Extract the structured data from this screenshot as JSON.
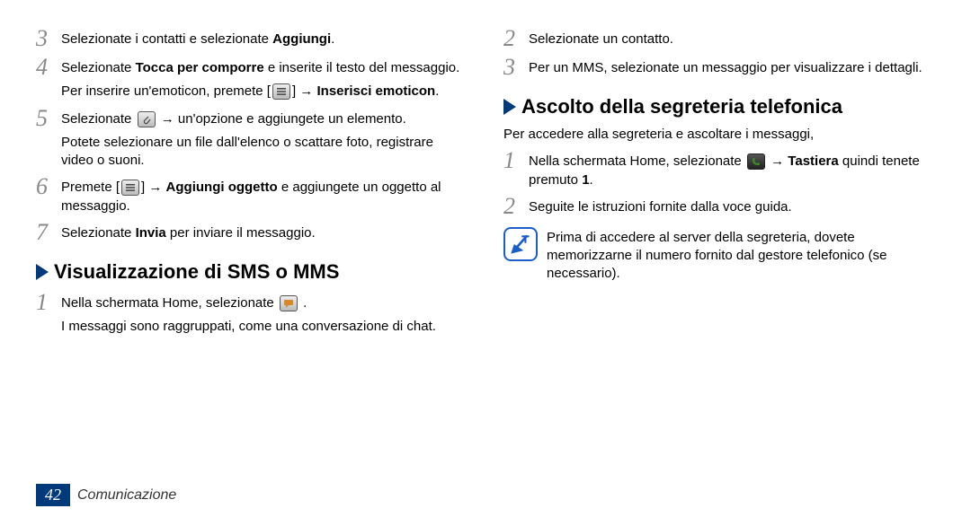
{
  "left": {
    "steps": [
      {
        "num": "3",
        "parts": [
          {
            "t": "Selezionate i contatti e selezionate "
          },
          {
            "t": "Aggiungi",
            "b": true
          },
          {
            "t": "."
          }
        ]
      },
      {
        "num": "4",
        "parts": [
          {
            "t": "Selezionate "
          },
          {
            "t": "Tocca per comporre",
            "b": true
          },
          {
            "t": " e inserite il testo del messaggio."
          }
        ],
        "sub": [
          {
            "t": "Per inserire un'emoticon, premete ["
          },
          {
            "icon": "menu"
          },
          {
            "t": "] → "
          },
          {
            "t": "Inserisci emoticon",
            "b": true
          },
          {
            "t": "."
          }
        ]
      },
      {
        "num": "5",
        "parts": [
          {
            "t": "Selezionate "
          },
          {
            "icon": "attach"
          },
          {
            "t": " → un'opzione e aggiungete un elemento."
          }
        ],
        "sub": [
          {
            "t": "Potete selezionare un file dall'elenco o scattare foto, registrare video o suoni."
          }
        ]
      },
      {
        "num": "6",
        "parts": [
          {
            "t": "Premete ["
          },
          {
            "icon": "menu"
          },
          {
            "t": "] → "
          },
          {
            "t": "Aggiungi oggetto",
            "b": true
          },
          {
            "t": " e aggiungete un oggetto al messaggio."
          }
        ]
      },
      {
        "num": "7",
        "parts": [
          {
            "t": "Selezionate "
          },
          {
            "t": "Invia",
            "b": true
          },
          {
            "t": " per inviare il messaggio."
          }
        ]
      }
    ],
    "heading": "Visualizzazione di SMS o MMS",
    "afterSteps": [
      {
        "num": "1",
        "parts": [
          {
            "t": "Nella schermata Home, selezionate "
          },
          {
            "icon": "msg"
          },
          {
            "t": " ."
          }
        ],
        "sub": [
          {
            "t": "I messaggi sono raggruppati, come una conversazione di chat."
          }
        ]
      }
    ]
  },
  "right": {
    "topSteps": [
      {
        "num": "2",
        "parts": [
          {
            "t": "Selezionate un contatto."
          }
        ]
      },
      {
        "num": "3",
        "parts": [
          {
            "t": "Per un MMS, selezionate un messaggio per visualizzare i dettagli."
          }
        ]
      }
    ],
    "heading": "Ascolto della segreteria telefonica",
    "desc": "Per accedere alla segreteria e ascoltare i messaggi,",
    "steps": [
      {
        "num": "1",
        "parts": [
          {
            "t": "Nella schermata Home, selezionate "
          },
          {
            "icon": "phone"
          },
          {
            "t": " → "
          },
          {
            "t": "Tastiera",
            "b": true
          },
          {
            "t": " quindi tenete premuto "
          },
          {
            "t": "1",
            "b": true
          },
          {
            "t": "."
          }
        ]
      },
      {
        "num": "2",
        "parts": [
          {
            "t": "Seguite le istruzioni fornite dalla voce guida."
          }
        ]
      }
    ],
    "note": "Prima di accedere al server della segreteria, dovete memorizzarne il numero fornito dal gestore telefonico (se necessario)."
  },
  "footer": {
    "page": "42",
    "section": "Comunicazione"
  }
}
